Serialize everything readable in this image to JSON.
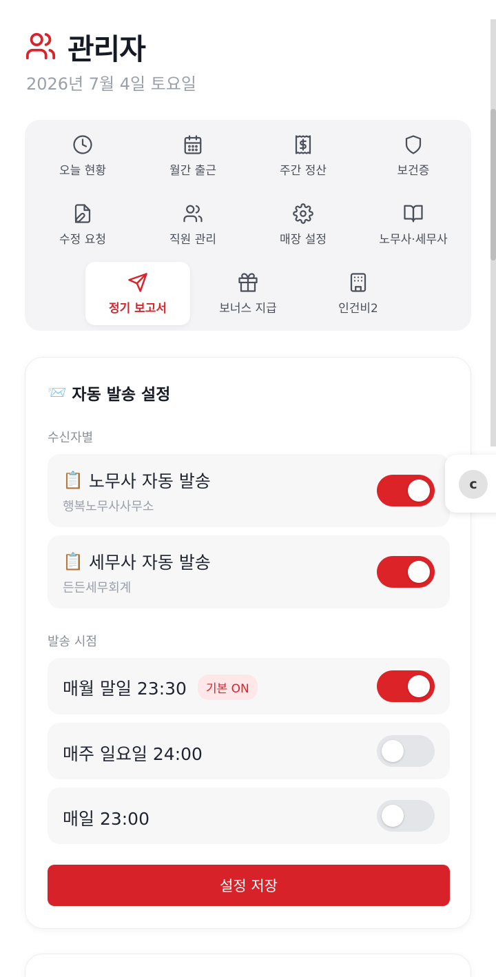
{
  "header": {
    "title": "관리자",
    "date": "2026년 7월 4일 토요일",
    "icon": "users-icon",
    "accent_color": "#d9232a"
  },
  "menu": {
    "items": [
      {
        "label": "오늘 현황",
        "icon": "clock-icon"
      },
      {
        "label": "월간 출근",
        "icon": "calendar-icon"
      },
      {
        "label": "주간 정산",
        "icon": "receipt-icon"
      },
      {
        "label": "보건증",
        "icon": "shield-icon"
      },
      {
        "label": "수정 요청",
        "icon": "file-edit-icon"
      },
      {
        "label": "직원 관리",
        "icon": "users-icon"
      },
      {
        "label": "매장 설정",
        "icon": "gear-icon"
      },
      {
        "label": "노무사·세무사",
        "icon": "book-open-icon"
      },
      {
        "label": "정기 보고서",
        "icon": "send-icon",
        "active": true
      },
      {
        "label": "보너스 지급",
        "icon": "gift-icon"
      },
      {
        "label": "인건비2",
        "icon": "building-icon"
      }
    ]
  },
  "settings": {
    "title": "자동 발송 설정",
    "title_emoji": "📨",
    "recipient_section_label": "수신자별",
    "recipients": [
      {
        "emoji": "📋",
        "label": "노무사 자동 발송",
        "sub": "행복노무사사무소",
        "enabled": true
      },
      {
        "emoji": "📋",
        "label": "세무사 자동 발송",
        "sub": "든든세무회계",
        "enabled": true
      }
    ],
    "timing_section_label": "발송 시점",
    "timings": [
      {
        "label": "매월 말일 23:30",
        "badge": "기본 ON",
        "enabled": true
      },
      {
        "label": "매주 일요일 24:00",
        "enabled": false
      },
      {
        "label": "매일 23:00",
        "enabled": false
      }
    ],
    "save_label": "설정 저장"
  },
  "floating": {
    "label": "c"
  }
}
